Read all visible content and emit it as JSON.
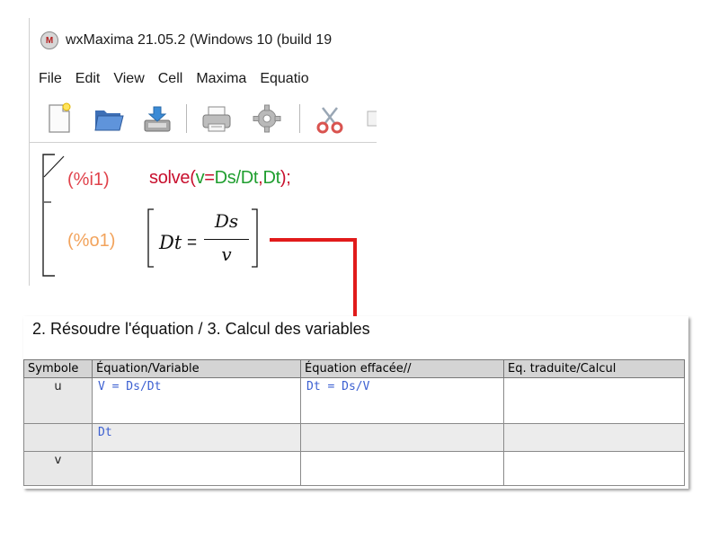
{
  "window": {
    "title": "wxMaxima 21.05.2 (Windows 10 (build 19",
    "app_icon": "wxmaxima-app-icon"
  },
  "menu": {
    "items": [
      "File",
      "Edit",
      "View",
      "Cell",
      "Maxima",
      "Equatio"
    ]
  },
  "toolbar": {
    "icons": [
      "new-document-icon",
      "open-folder-icon",
      "save-icon",
      "print-icon",
      "settings-gear-icon",
      "cut-scissors-icon"
    ]
  },
  "worksheet": {
    "input_label": "(%i1)",
    "input": {
      "fn": "solve(",
      "lhs_var": "v",
      "eq": "=",
      "rhs": "Ds/Dt",
      "comma": ",",
      "arg": "Dt",
      "close": ");"
    },
    "output_label": "(%o1)",
    "result": {
      "lhs": "Dt",
      "eq": "=",
      "numerator": "Ds",
      "denominator": "v"
    }
  },
  "document": {
    "title": "2. Résoudre l'équation / 3. Calcul des variables",
    "columns": [
      "Symbole",
      "Équation/Variable",
      "Équation effacée//",
      "Eq. traduite/Calcul"
    ],
    "rows": [
      {
        "symbol": "u",
        "equation": "V = Ds/Dt",
        "erased": "Dt = Ds/V",
        "translated": ""
      },
      {
        "symbol": "",
        "equation": "Dt",
        "erased": "",
        "translated": ""
      },
      {
        "symbol": "v",
        "equation": "",
        "erased": "",
        "translated": ""
      }
    ]
  },
  "colors": {
    "input_label": "#e0424b",
    "output_label": "#f2a35c",
    "function": "#c8102e",
    "variable": "#1f9e2f",
    "connector": "#e11b1b",
    "handwriting": "#3b5fd1"
  }
}
